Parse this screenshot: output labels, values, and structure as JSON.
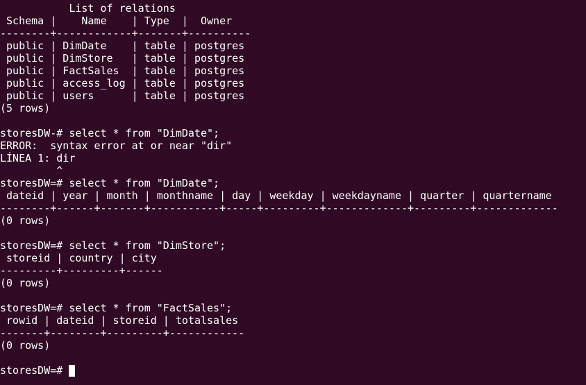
{
  "terminal": {
    "lines": [
      "           List of relations",
      " Schema |    Name    | Type  |  Owner",
      "--------+------------+-------+----------",
      " public | DimDate    | table | postgres",
      " public | DimStore   | table | postgres",
      " public | FactSales  | table | postgres",
      " public | access_log | table | postgres",
      " public | users      | table | postgres",
      "(5 rows)",
      "",
      "storesDW-# select * from \"DimDate\";",
      "ERROR:  syntax error at or near \"dir\"",
      "LÍNEA 1: dir",
      "         ^",
      "storesDW=# select * from \"DimDate\";",
      " dateid | year | month | monthname | day | weekday | weekdayname | quarter | quartername",
      "--------+------+-------+-----------+-----+---------+-------------+---------+-------------",
      "(0 rows)",
      "",
      "storesDW=# select * from \"DimStore\";",
      " storeid | country | city",
      "---------+---------+------",
      "(0 rows)",
      "",
      "storesDW=# select * from \"FactSales\";",
      " rowid | dateid | storeid | totalsales",
      "-------+--------+---------+------------",
      "(0 rows)",
      ""
    ],
    "prompt": "storesDW=# "
  },
  "colors": {
    "background": "#300a24",
    "foreground": "#ffffff"
  }
}
